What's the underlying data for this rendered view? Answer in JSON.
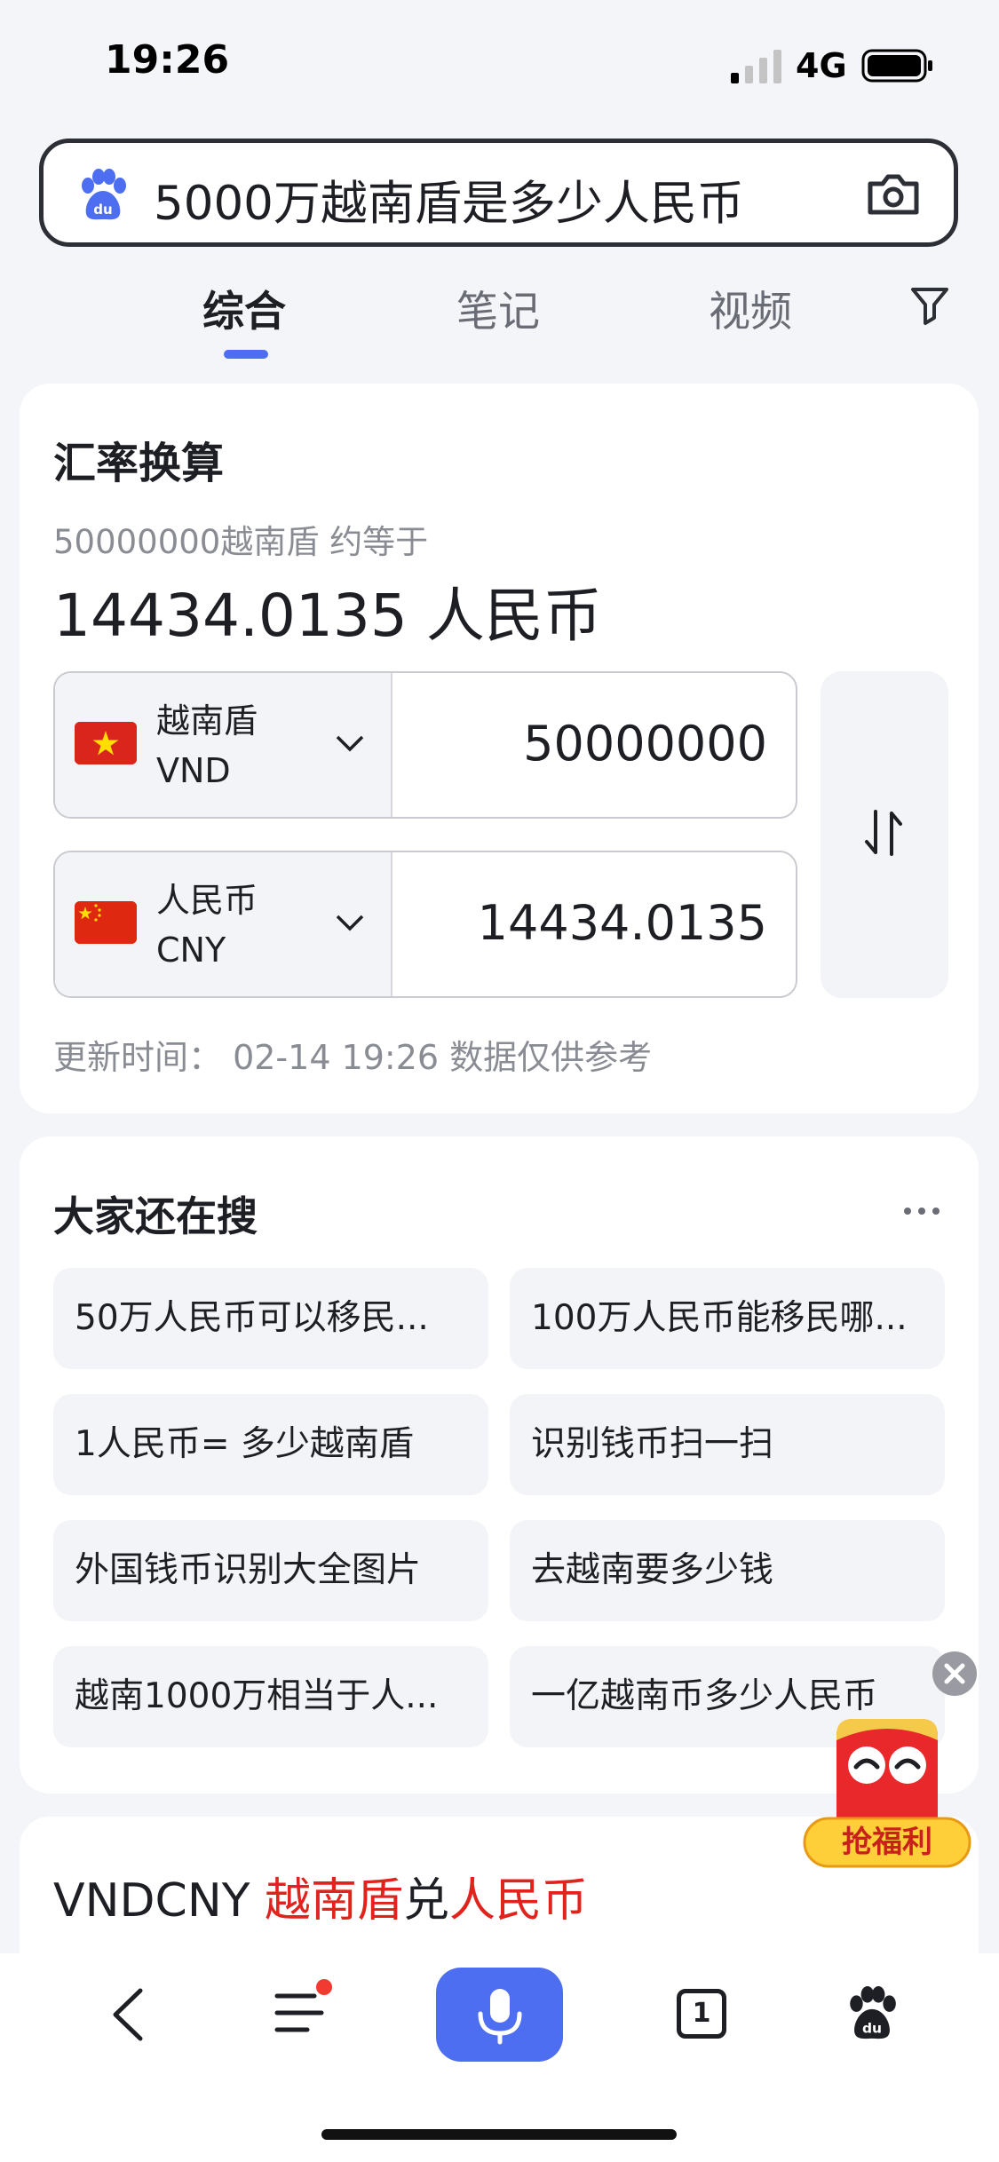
{
  "status_bar": {
    "time": "19:26",
    "network": "4G"
  },
  "search": {
    "query": "5000万越南盾是多少人民币"
  },
  "tabs": [
    {
      "label": "综合",
      "active": true
    },
    {
      "label": "笔记",
      "active": false
    },
    {
      "label": "视频",
      "active": false
    }
  ],
  "converter": {
    "title": "汇率换算",
    "equation_text": "50000000越南盾 约等于",
    "result_text": "14434.0135 人民币",
    "from": {
      "name": "越南盾",
      "code": "VND",
      "value": "50000000"
    },
    "to": {
      "name": "人民币",
      "code": "CNY",
      "value": "14434.0135"
    },
    "update_text": "更新时间：  02-14 19:26 数据仅供参考"
  },
  "related": {
    "title": "大家还在搜",
    "items": [
      "50万人民币可以移民...",
      "100万人民币能移民哪...",
      "1人民币= 多少越南盾",
      "识别钱币扫一扫",
      "外国钱币识别大全图片",
      "去越南要多少钱",
      "越南1000万相当于人...",
      "一亿越南币多少人民币"
    ]
  },
  "pair": {
    "code": "VNDCNY",
    "from_name": "越南盾",
    "connector": "兑",
    "to_name": "人民币"
  },
  "promo": {
    "label": "抢福利"
  },
  "bottom_nav": {
    "tab_count": "1"
  },
  "colors": {
    "accent": "#4e6ef2",
    "red": "#e0231c"
  }
}
